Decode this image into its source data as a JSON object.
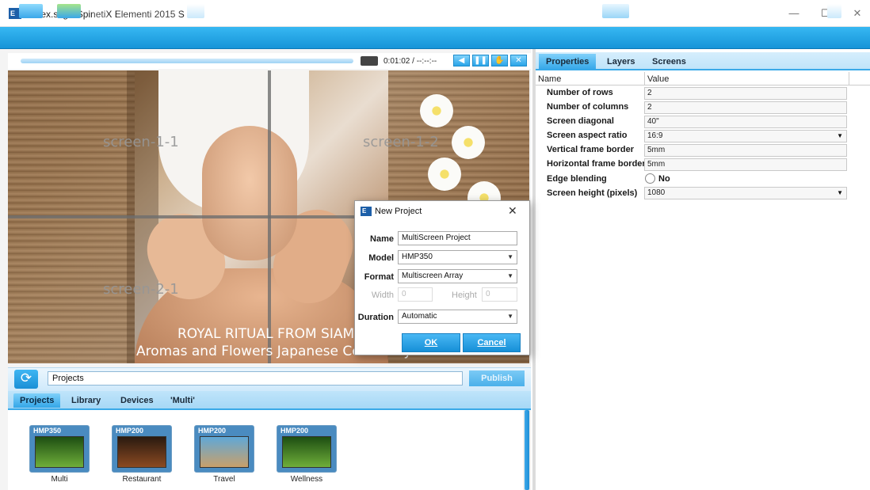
{
  "app": {
    "title": "/index.svg - SpinetiX Elementi 2015 S",
    "icon_text": "E"
  },
  "window_controls": {
    "minimize": "—",
    "maximize": "☐",
    "close": "✕"
  },
  "toolbar": {
    "accent": "#1694d8"
  },
  "player": {
    "time": "0:01:02 / --:--:--"
  },
  "preview": {
    "screens": [
      "screen-1-1",
      "screen-1-2",
      "screen-2-1"
    ],
    "caption_line1": "ROYAL RITUAL FROM SIAM",
    "caption_line2": "Aromas and Flowers Japanese Ceremony"
  },
  "projects_bar": {
    "input_value": "Projects",
    "publish_label": "Publish"
  },
  "bottom_tabs": [
    {
      "label": "Projects",
      "active": true
    },
    {
      "label": "Library",
      "active": false
    },
    {
      "label": "Devices",
      "active": false
    },
    {
      "label": "'Multi'",
      "active": false
    }
  ],
  "projects": [
    {
      "badge": "HMP350",
      "name": "Multi"
    },
    {
      "badge": "HMP200",
      "name": "Restaurant"
    },
    {
      "badge": "HMP200",
      "name": "Travel"
    },
    {
      "badge": "HMP200",
      "name": "Wellness"
    }
  ],
  "right_tabs": [
    {
      "label": "Properties",
      "active": true
    },
    {
      "label": "Layers",
      "active": false
    },
    {
      "label": "Screens",
      "active": false
    }
  ],
  "properties": {
    "header_name": "Name",
    "header_value": "Value",
    "rows": [
      {
        "name": "Number of rows",
        "value": "2"
      },
      {
        "name": "Number of columns",
        "value": "2"
      },
      {
        "name": "Screen diagonal",
        "value": "40\""
      },
      {
        "name": "Screen aspect ratio",
        "value": "16:9"
      },
      {
        "name": "Vertical frame border",
        "value": "5mm"
      },
      {
        "name": "Horizontal frame border",
        "value": "5mm"
      },
      {
        "name": "Edge blending",
        "value": "No"
      },
      {
        "name": "Screen height (pixels)",
        "value": "1080"
      }
    ]
  },
  "dialog": {
    "title": "New Project",
    "name_label": "Name",
    "name_value": "MultiScreen Project",
    "model_label": "Model",
    "model_value": "HMP350",
    "format_label": "Format",
    "format_value": "Multiscreen Array",
    "width_label": "Width",
    "width_value": "0",
    "height_label": "Height",
    "height_value": "0",
    "duration_label": "Duration",
    "duration_value": "Automatic",
    "ok_label": "OK",
    "cancel_label": "Cancel"
  }
}
